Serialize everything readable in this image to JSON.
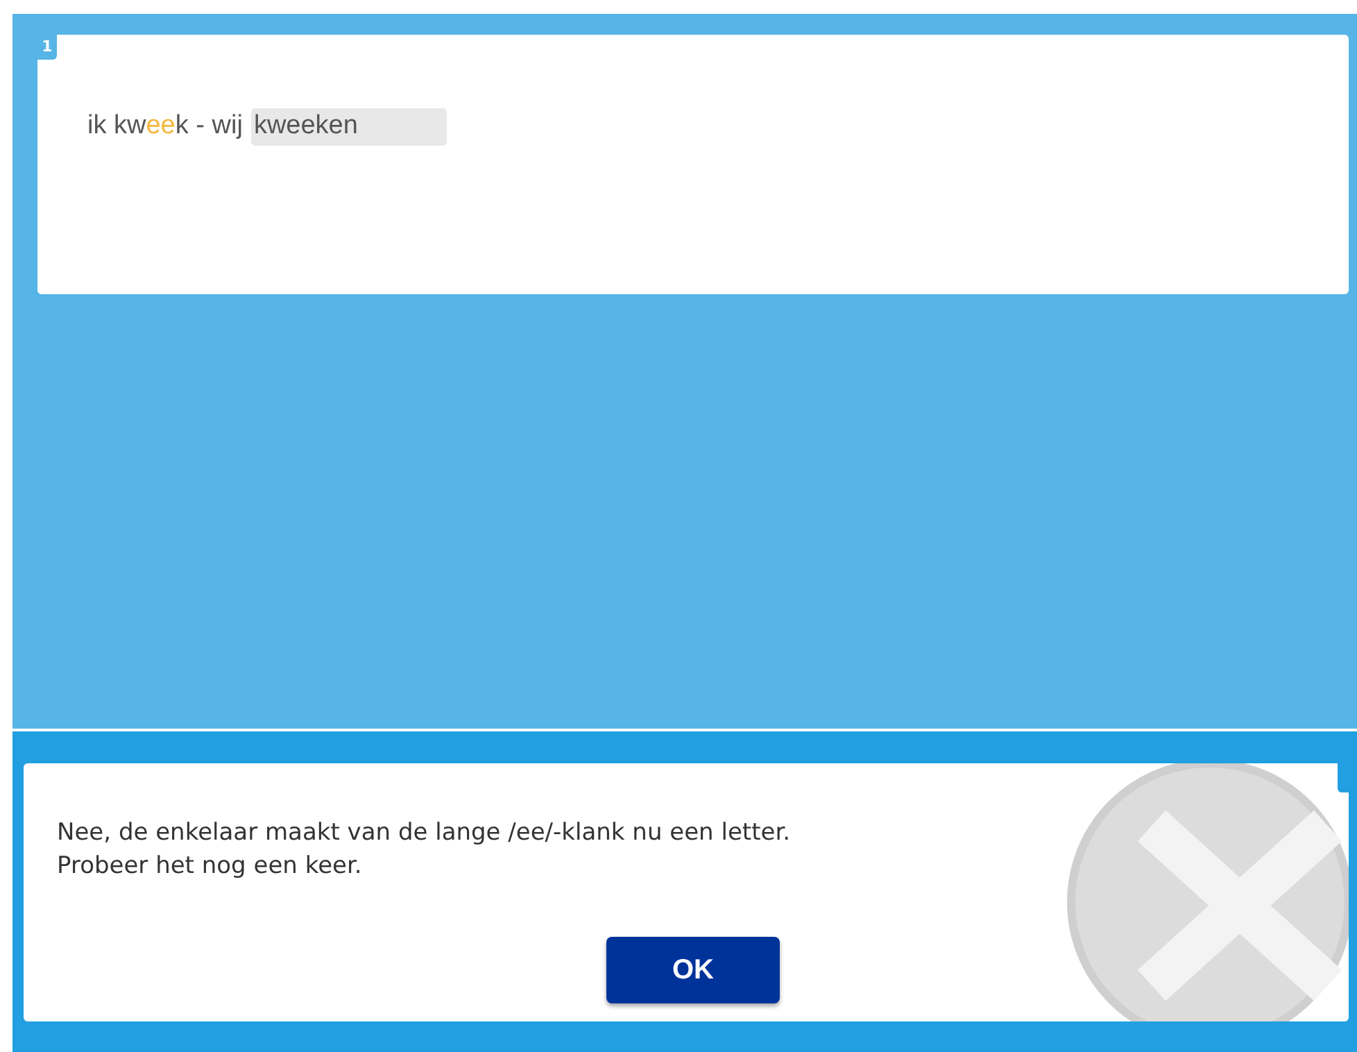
{
  "question": {
    "number": "1",
    "prompt_segments": [
      {
        "text": "ik kw",
        "highlighted": false
      },
      {
        "text": "ee",
        "highlighted": true
      },
      {
        "text": "k - wij",
        "highlighted": false
      }
    ],
    "answer": {
      "value": "kweeken"
    }
  },
  "feedback": {
    "kind": "wrong",
    "lines": [
      "Nee, de enkelaar maakt van de lange /ee/-klank nu een letter.",
      "Probeer het nog een keer."
    ],
    "button": "OK"
  }
}
